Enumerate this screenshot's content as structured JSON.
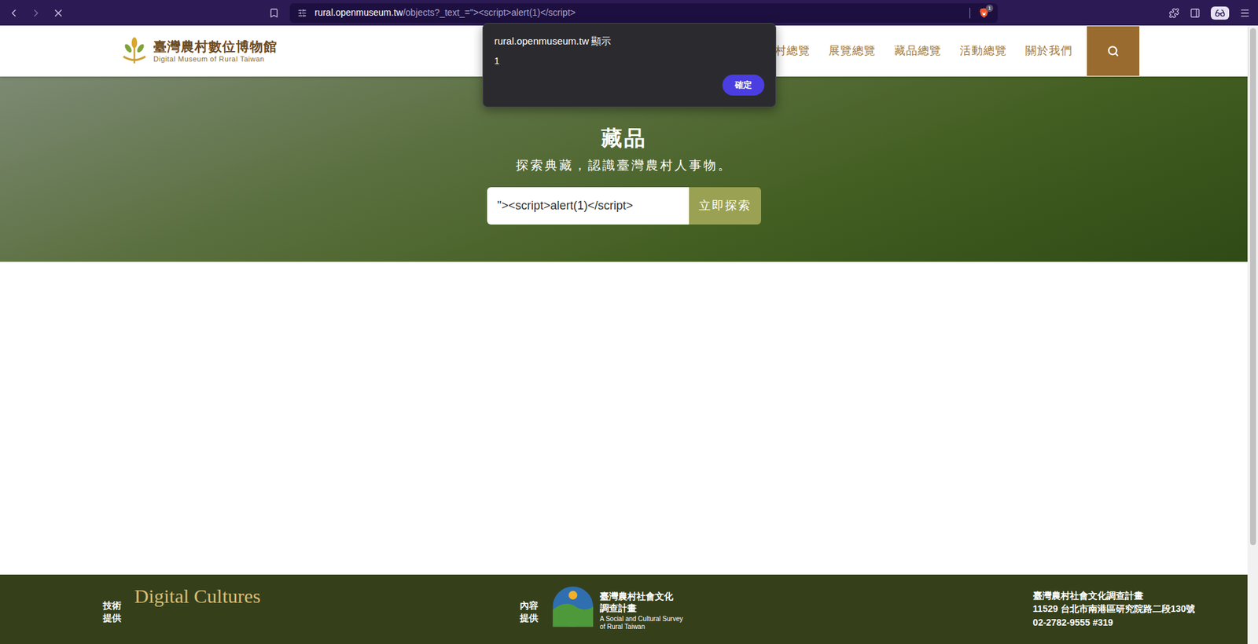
{
  "browser": {
    "url_host": "rural.openmuseum.tw",
    "url_path": "/objects?_text_=\"><script>alert(1)</script>",
    "shield_badge": "1"
  },
  "header": {
    "logo_title": "臺灣農村數位博物館",
    "logo_subtitle": "Digital Museum of Rural Taiwan",
    "nav": [
      "村總覽",
      "展覽總覽",
      "藏品總覽",
      "活動總覽",
      "關於我們"
    ]
  },
  "hero": {
    "title": "藏品",
    "subtitle": "探索典藏，認識臺灣農村人事物。",
    "search_value": "\"><script>alert(1)</script>",
    "search_button": "立即探索"
  },
  "footer": {
    "tech_label": "技術提供",
    "tech_logo": "Digital Cultures",
    "content_label": "內容提供",
    "content_logo_title": "臺灣農村社會文化調查計畫",
    "content_logo_subtitle": "A Social and Cultural Survey of Rural Taiwan",
    "contact": [
      "臺灣農村社會文化調查計畫",
      "11529 台北市南港區研究院路二段130號",
      "02-2782-9555 #319"
    ]
  },
  "alert": {
    "title": "rural.openmuseum.tw 顯示",
    "message": "1",
    "button": "確定"
  }
}
